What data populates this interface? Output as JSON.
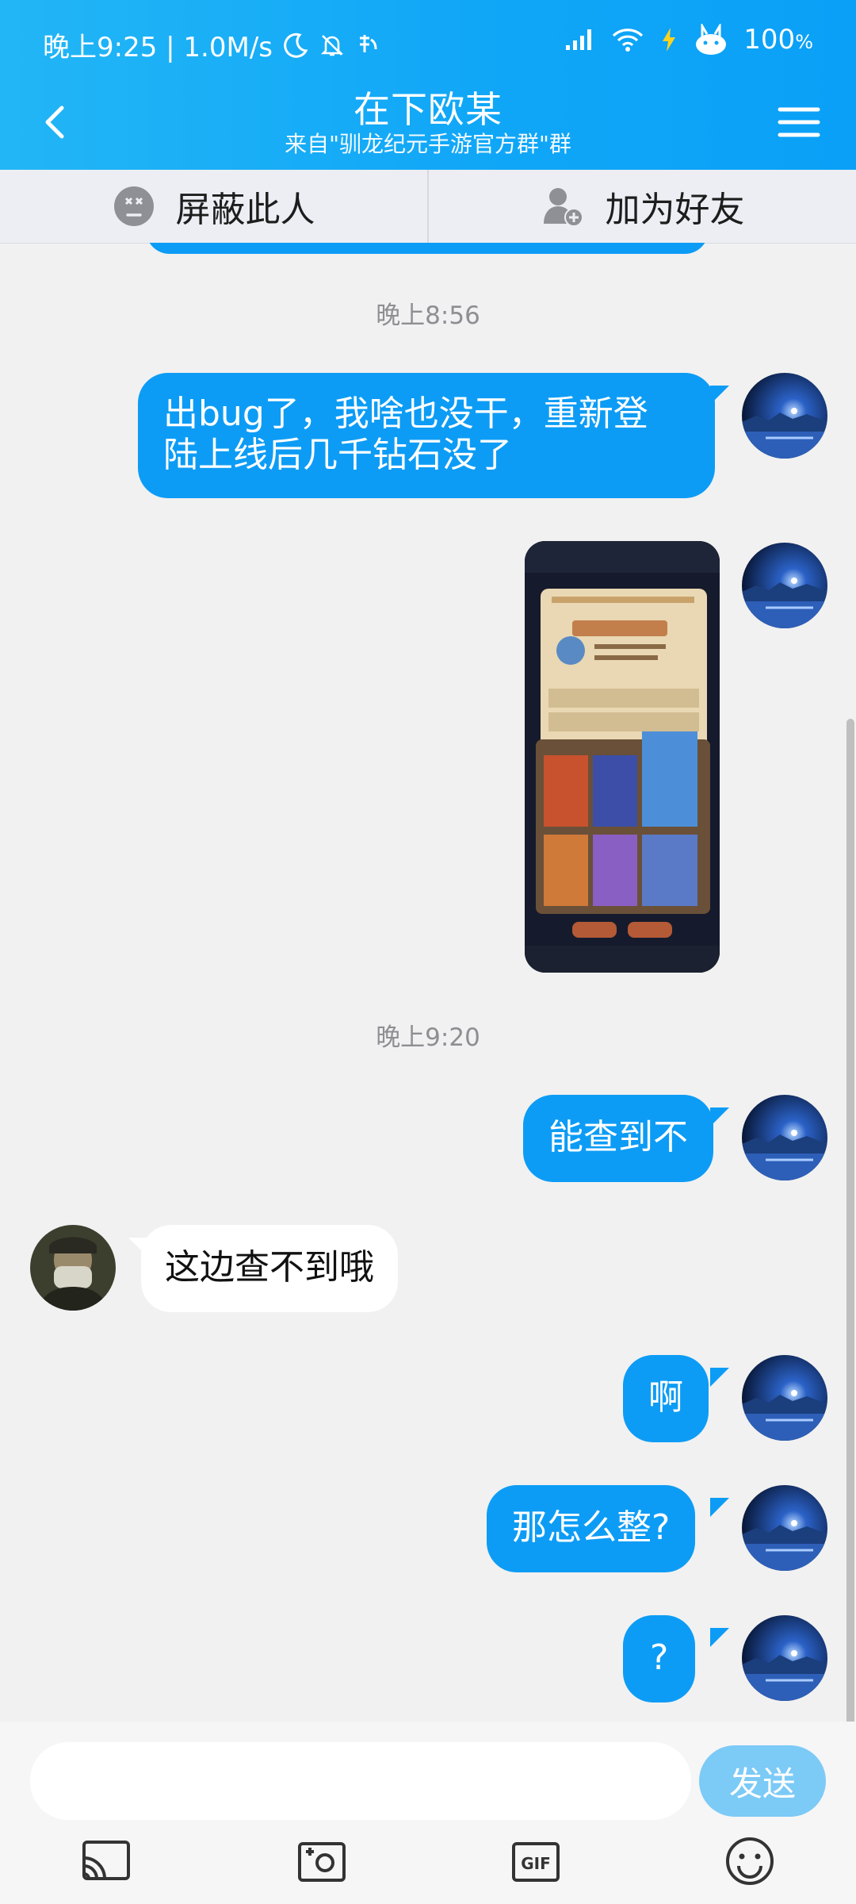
{
  "status_bar": {
    "time_speed": "晚上9:25 | 1.0M/s",
    "battery": "100",
    "battery_unit": "%",
    "icons": [
      "moon-icon",
      "bell-off-icon",
      "app-notify-icon",
      "signal-icon",
      "wifi-icon",
      "charging-icon",
      "bunny-icon"
    ]
  },
  "header": {
    "title": "在下欧某",
    "subtitle": "来自\"驯龙纪元手游官方群\"群",
    "back_icon": "chevron-left-icon",
    "menu_icon": "hamburger-menu-icon",
    "color": "#11a7f7"
  },
  "actions": {
    "block_label": "屏蔽此人",
    "add_friend_label": "加为好友"
  },
  "messages": {
    "time1": "晚上8:56",
    "m1": "出bug了，我啥也没干，重新登陆上线后几千钻石没了",
    "m1_line1": "出bug了，我啥也没干，重新登",
    "m1_line2": "陆上线后几千钻石没了",
    "time2": "晚上9:20",
    "m3": "能查到不",
    "m4": "这边查不到哦",
    "m5": "啊",
    "m6": "那怎么整?",
    "m7": "?"
  },
  "input": {
    "placeholder": "",
    "send_label": "发送"
  },
  "toolbar": {
    "icons": [
      "screen-cast-icon",
      "camera-icon",
      "gif-icon",
      "emoji-icon"
    ]
  },
  "colors": {
    "my_bubble": "#0d9cf5",
    "send_button": "#7ccaf6",
    "background": "#f1f1f1"
  }
}
